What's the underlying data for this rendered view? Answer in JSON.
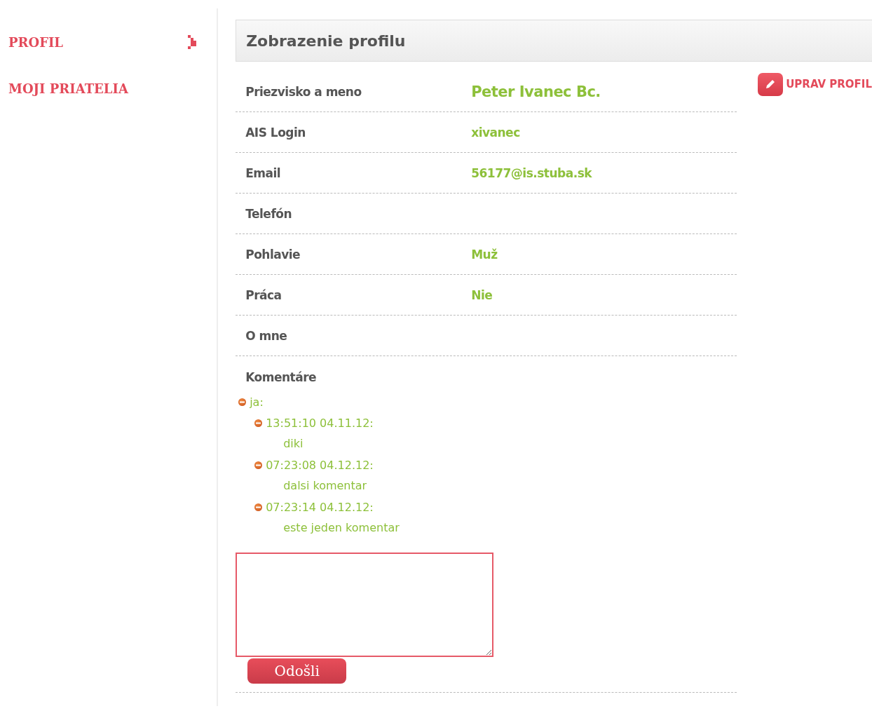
{
  "sidebar": {
    "items": [
      {
        "label": "PROFIL",
        "selected": true
      },
      {
        "label": "MOJI PRIATELIA",
        "selected": false
      }
    ]
  },
  "header": {
    "title": "Zobrazenie profilu"
  },
  "edit_button": {
    "label": "UPRAV PROFIL"
  },
  "fields": [
    {
      "label": "Priezvisko a meno",
      "value": "Peter Ivanec Bc.",
      "kind": "name"
    },
    {
      "label": "AIS Login",
      "value": "xivanec",
      "kind": "plain"
    },
    {
      "label": "Email",
      "value": "56177@is.stuba.sk",
      "kind": "plain"
    },
    {
      "label": "Telefón"
    },
    {
      "label": "Pohlavie",
      "value": "Muž",
      "kind": "plain"
    },
    {
      "label": "Práca",
      "value": "Nie",
      "kind": "plain"
    },
    {
      "label": "O mne"
    }
  ],
  "comments": {
    "label": "Komentáre",
    "tree": [
      {
        "author": "ja:",
        "expanded": true,
        "children": [
          {
            "time": "13:51:10 04.11.12:",
            "text": "diki",
            "expanded": true
          },
          {
            "time": "07:23:08 04.12.12:",
            "text": "dalsi komentar",
            "expanded": true
          },
          {
            "time": "07:23:14 04.12.12:",
            "text": "este jeden komentar",
            "expanded": true
          }
        ]
      }
    ]
  },
  "submit": {
    "label": "Odošli"
  }
}
